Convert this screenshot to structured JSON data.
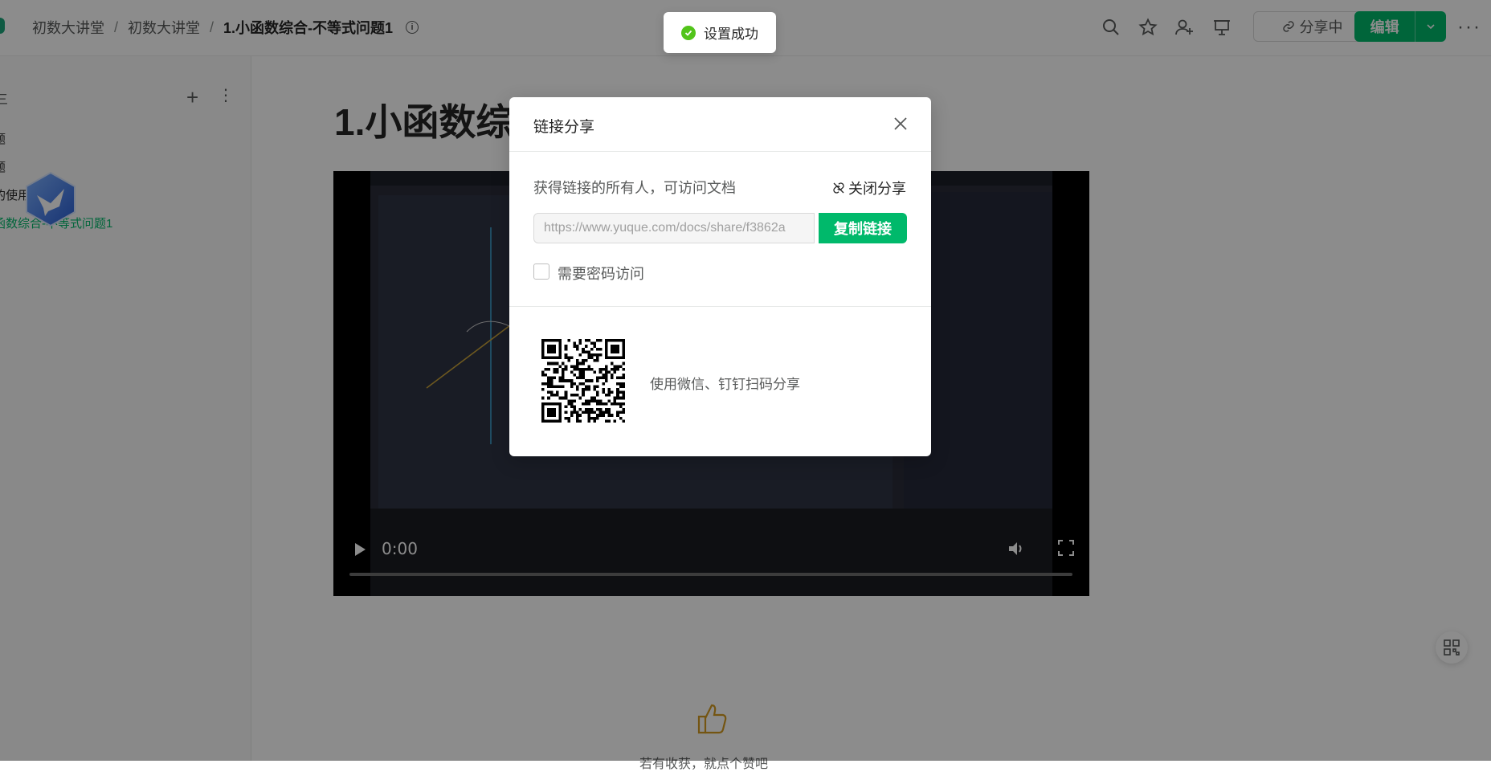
{
  "breadcrumb": {
    "items": [
      "初数大讲堂",
      "初数大讲堂"
    ],
    "separator": "/",
    "current": "1.小函数综合-不等式问题1"
  },
  "toolbar": {
    "share_label": "分享中",
    "edit_label": "编辑",
    "more_label": "···"
  },
  "sidebar": {
    "title_fragment": "三",
    "items": [
      {
        "label": "题"
      },
      {
        "label": "题"
      },
      {
        "label": "的使用"
      },
      {
        "label": "函数综合-不等式问题1"
      }
    ]
  },
  "document": {
    "title": "1.小函数综",
    "video_time": "0:00",
    "like_text": "若有收获，就点个赞吧"
  },
  "toast": {
    "message": "设置成功"
  },
  "share_modal": {
    "title": "链接分享",
    "permission_text": "获得链接的所有人，可访问文档",
    "close_share_label": "关闭分享",
    "link_value": "https://www.yuque.com/docs/share/f3862a",
    "copy_button_label": "复制链接",
    "password_label": "需要密码访问",
    "password_checked": false,
    "qr_caption": "使用微信、钉钉扫码分享"
  },
  "colors": {
    "brand_green": "#00b96b",
    "success_green": "#52c41a",
    "mask": "rgba(0,0,0,0.45)"
  }
}
